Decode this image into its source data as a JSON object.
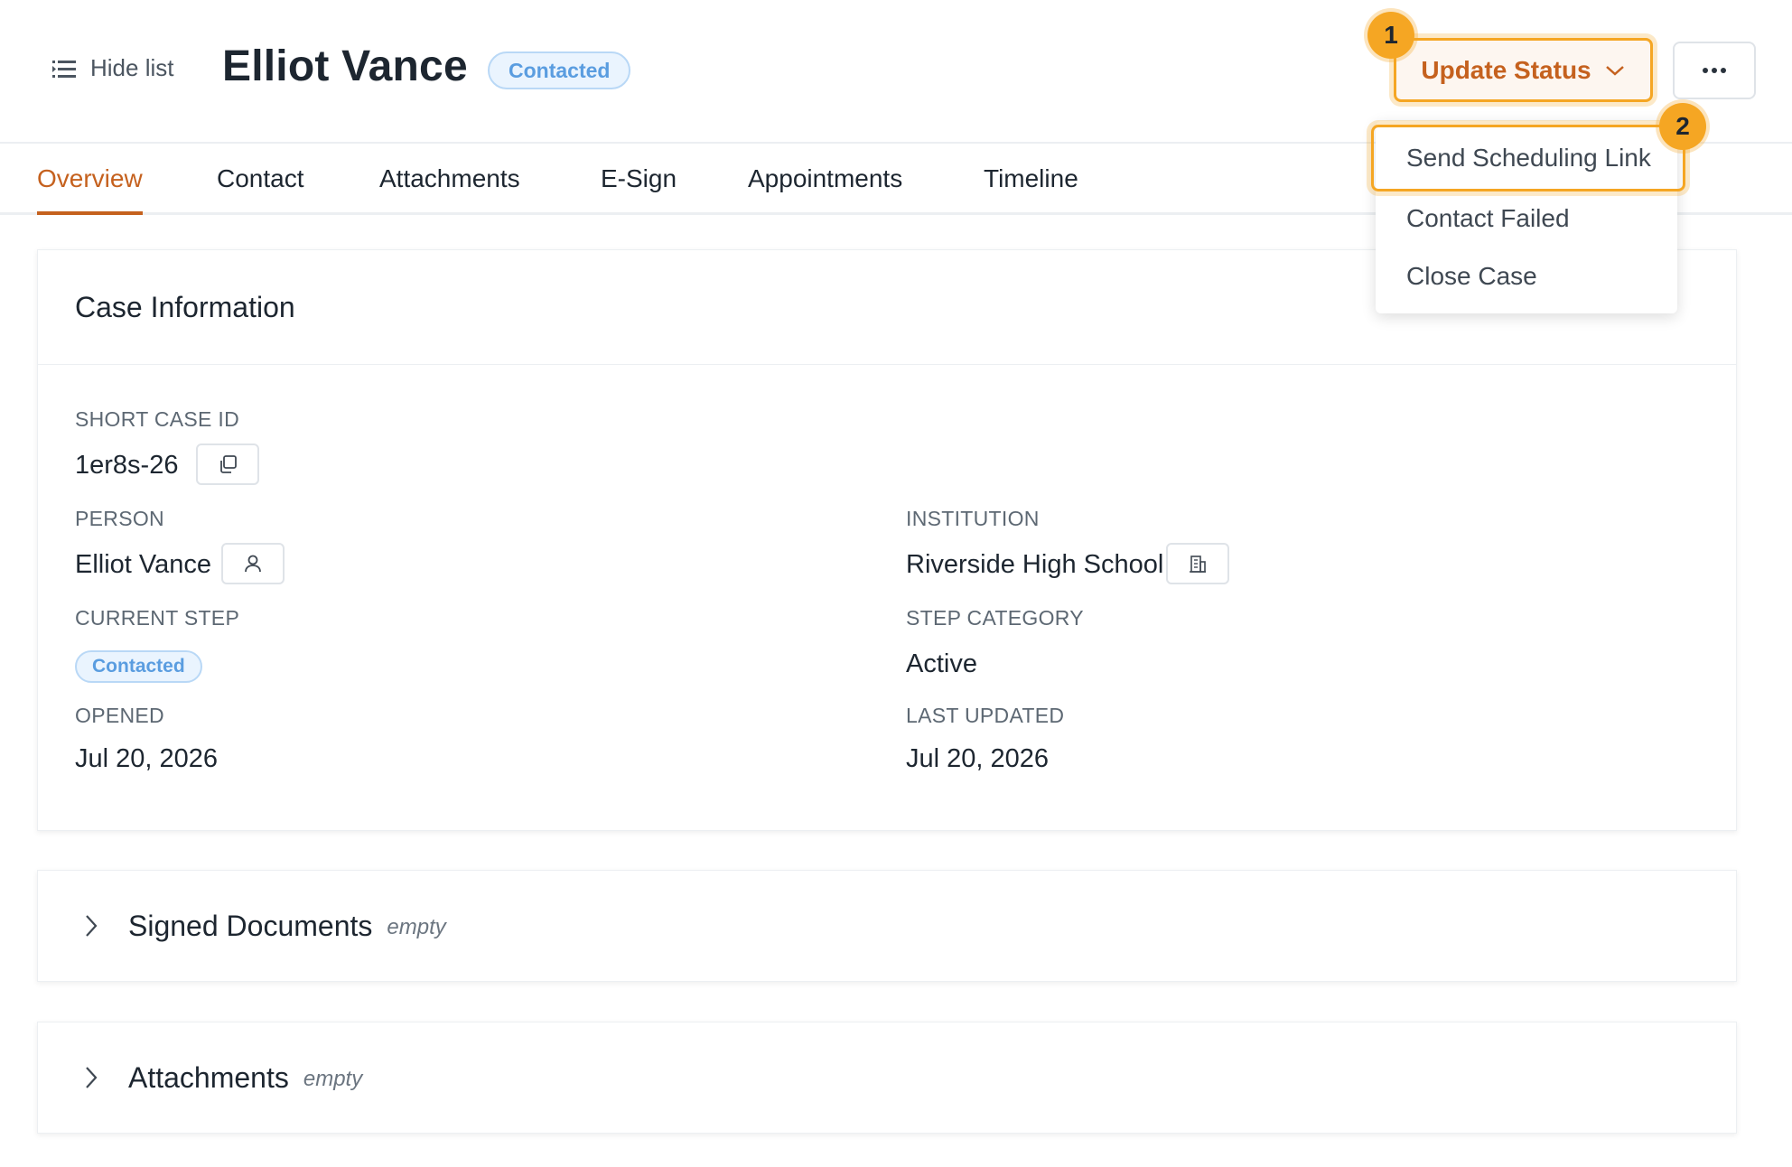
{
  "header": {
    "hide_list_label": "Hide list",
    "title": "Elliot Vance",
    "status_badge": "Contacted",
    "update_status_label": "Update Status",
    "more_icon": "more-horizontal-icon"
  },
  "step_markers": [
    "1",
    "2"
  ],
  "tabs": [
    {
      "label": "Overview",
      "active": true
    },
    {
      "label": "Contact",
      "active": false
    },
    {
      "label": "Attachments",
      "active": false
    },
    {
      "label": "E-Sign",
      "active": false
    },
    {
      "label": "Appointments",
      "active": false
    },
    {
      "label": "Timeline",
      "active": false
    }
  ],
  "case_info": {
    "title": "Case Information",
    "short_case_id_label": "SHORT CASE ID",
    "short_case_id": "1er8s-26",
    "person_label": "PERSON",
    "person": "Elliot Vance",
    "institution_label": "INSTITUTION",
    "institution": "Riverside High School",
    "current_step_label": "CURRENT STEP",
    "current_step": "Contacted",
    "step_category_label": "STEP CATEGORY",
    "step_category": "Active",
    "opened_label": "OPENED",
    "opened": "Jul 20, 2026",
    "last_updated_label": "LAST UPDATED",
    "last_updated": "Jul 20, 2026"
  },
  "sections": [
    {
      "title": "Signed Documents",
      "state": "empty"
    },
    {
      "title": "Attachments",
      "state": "empty"
    }
  ],
  "dropdown": {
    "items": [
      "Send Scheduling Link",
      "Contact Failed",
      "Close Case"
    ]
  },
  "colors": {
    "accent": "#c5611e",
    "highlight": "#f5a623",
    "badge_text": "#5a9de0",
    "badge_bg": "#eaf4fe"
  }
}
